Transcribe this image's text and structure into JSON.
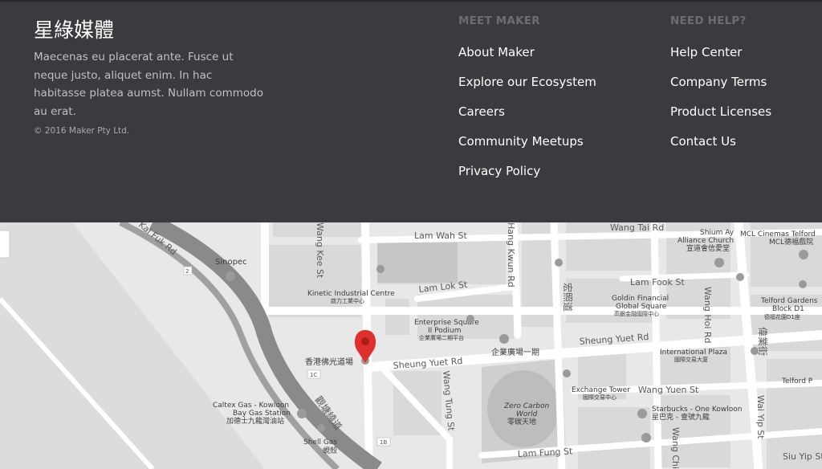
{
  "footer": {
    "brand": "星綠媒體",
    "blurb": "Maecenas eu placerat ante. Fusce ut neque justo, aliquet enim. In hac habitasse platea aumst. Nullam commodo au erat.",
    "copyright": "© 2016 Maker Pty Ltd.",
    "columns": [
      {
        "heading": "MEET MAKER",
        "links": [
          "About Maker",
          "Explore our Ecosystem",
          "Careers",
          "Community Meetups",
          "Privacy Policy"
        ]
      },
      {
        "heading": "NEED HELP?",
        "links": [
          "Help Center",
          "Company Terms",
          "Product Licenses",
          "Contact Us"
        ]
      }
    ]
  },
  "map": {
    "roads": {
      "lam_wah": "Lam Wah St",
      "lam_lok": "Lam Lok St",
      "lam_fook": "Lam Fook St",
      "sheung_yuet_w": "Sheung Yuet Rd",
      "sheung_yuet_e": "Sheung Yuet Rd",
      "wang_yuen": "Wang Yuen St",
      "lam_fung": "Lam Fung St",
      "wang_tung": "Wang Tung St",
      "kai_fuk": "Kai Fuk Rd",
      "wang_kee": "Wang Kee St",
      "hang_kwun": "Hang Kwun Rd",
      "wang_hoi": "Wang Hoi Rd",
      "wang_tai": "Wang Tai Rd",
      "wai_yip": "Wai Yip St",
      "wang_chiu": "Wang Chiu Rd",
      "siu_yip": "Siu Yip St",
      "kwun_tong_bypass_zh": "觀塘繞道",
      "hoi_bun_zh": "偉業街",
      "kai_fuk_zh": "宏照道"
    },
    "places": {
      "sinopec": "Sinopec",
      "kinetic_en": "Kinetic Industrial Centre",
      "kinetic_zh": "啟力工業中心",
      "enterprise_en": "Enterprise Square",
      "enterprise_en2": "II Podium",
      "enterprise_zh": "企業廣場二期平台",
      "enterprise_plaza_zh": "企業廣場一期",
      "fo_kwong_zh": "香港佛光道場",
      "caltex_en": "Caltex Gas - Kowloon",
      "caltex_en2": "Bay Gas Station",
      "caltex_zh": "加德士九龍灣油站",
      "shell_en": "Shell Gas",
      "shell_zh": "蜆殼",
      "zero_carbon_en": "Zero Carbon",
      "zero_carbon_en2": "World",
      "zero_carbon_zh": "零碳天地",
      "goldin_en": "Goldin Financial",
      "goldin_en2": "Global Square",
      "goldin_zh": "高銀金融國際中心",
      "intl_plaza_en": "International Plaza",
      "intl_plaza_zh": "國際交易大廈",
      "exchange_en": "Exchange Tower",
      "exchange_zh": "國際交易中心",
      "starbucks_en": "Starbucks - One Kowloon",
      "starbucks_zh": "星巴克 - 壹號九龍",
      "shium_en": "Shium Ay",
      "shium_en2": "Alliance Church",
      "shium_zh": "宣道會信愛堂",
      "mcl_en": "MCL Cinemas Telford",
      "mcl_zh": "MCL德福戲院",
      "telford_en": "Telford Gardens",
      "telford_en2": "Block D1",
      "telford_zh": "德福花園D1座",
      "telford_plaza": "Telford P",
      "route_1c": "1C",
      "route_1b": "1B",
      "route_2": "2"
    },
    "pin_color": "#e0302e"
  }
}
